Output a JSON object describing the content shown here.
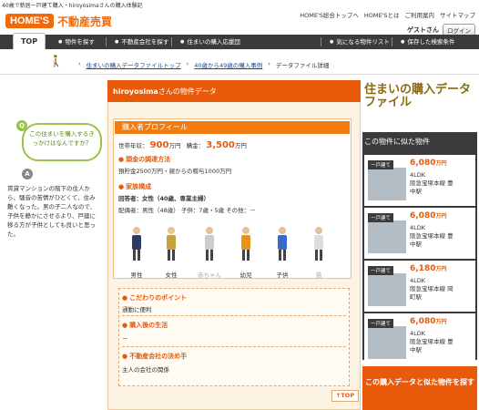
{
  "document_title": "40歳で新居一戸建て購入・hiroyosimaさんの購入体験記",
  "header": {
    "logo_brand": "HOME'S",
    "logo_sub": "不動産売買",
    "links": [
      "HOME'S総合トップへ",
      "HOME'Sとは",
      "ご利用案内",
      "サイトマップ"
    ],
    "guest_name": "ゲストさん",
    "login_label": "ログイン"
  },
  "nav": {
    "top_tab": "TOP",
    "items": [
      "物件を探す",
      "不動産会社を探す",
      "住まいの購入応援団",
      "気になる物件リスト",
      "保存した検索条件"
    ]
  },
  "breadcrumb": [
    "住まいの購入データファイルトップ",
    "40歳から49歳の購入事例",
    "データファイル詳細"
  ],
  "qa": {
    "q_badge": "Q",
    "question": "この住まいを購入するきっかけはなんですか？",
    "a_badge": "A",
    "answer": "賃貸マンションの階下の住人から、騒音の苦情がひどくて、住み難くなった。男の子二人なので、子供を静かにさせるより、戸建に移る方が子供としても良いと思った。"
  },
  "card": {
    "owner": "hiroyosima",
    "header_suffix": "さんの物件データ",
    "section_title": "購入者プロフィール",
    "income_label": "世帯年収",
    "income_value": "900",
    "income_unit": "万円",
    "price_label": "購金",
    "price_value": "3,500",
    "price_unit": "万円",
    "funding_head": "頭金の調達方法",
    "funding_text": "預貯金2500万円・親からの贈与1000万円",
    "family_head": "家族構成",
    "family_buyer": "回答者：女性（40歳、専業主婦）",
    "family_members": "配偶者：男性（48歳） 子供：7歳・5歳 その他：－",
    "figures": [
      "男性",
      "女性",
      "赤ちゃん",
      "幼児",
      "子供",
      "猫"
    ],
    "figure_colors": [
      "#2b3b66",
      "#c8a23a",
      "#cccccc",
      "#e8921a",
      "#3a6ac8",
      "#dddddd"
    ],
    "point_head": "こだわりのポイント",
    "point_text": "通勤に便利",
    "life_head": "購入後の生活",
    "life_text": "－",
    "decision_head": "不動産会社の決め手",
    "decision_text": "主人の会社の関係",
    "top_button": "TOP"
  },
  "right": {
    "art_title": "住まいの購入データファイル",
    "similar_title": "この物件に似た物件",
    "items": [
      {
        "badge": "一戸建て",
        "price": "6,080",
        "unit": "万円",
        "layout": "4LDK",
        "line": "阪急宝塚本線 豊",
        "station": "中駅"
      },
      {
        "badge": "一戸建て",
        "price": "6,080",
        "unit": "万円",
        "layout": "4LDK",
        "line": "阪急宝塚本線 豊",
        "station": "中駅"
      },
      {
        "badge": "一戸建て",
        "price": "6,180",
        "unit": "万円",
        "layout": "4LDK",
        "line": "阪急宝塚本線 岡",
        "station": "町駅"
      },
      {
        "badge": "一戸建て",
        "price": "6,080",
        "unit": "万円",
        "layout": "4LDK",
        "line": "阪急宝塚本線 豊",
        "station": "中駅"
      }
    ],
    "cta": "この購入データと似た物件を探す"
  },
  "colors": {
    "accent": "#e85a0a",
    "nav": "#3b3b3b",
    "green": "#9ac24a"
  }
}
